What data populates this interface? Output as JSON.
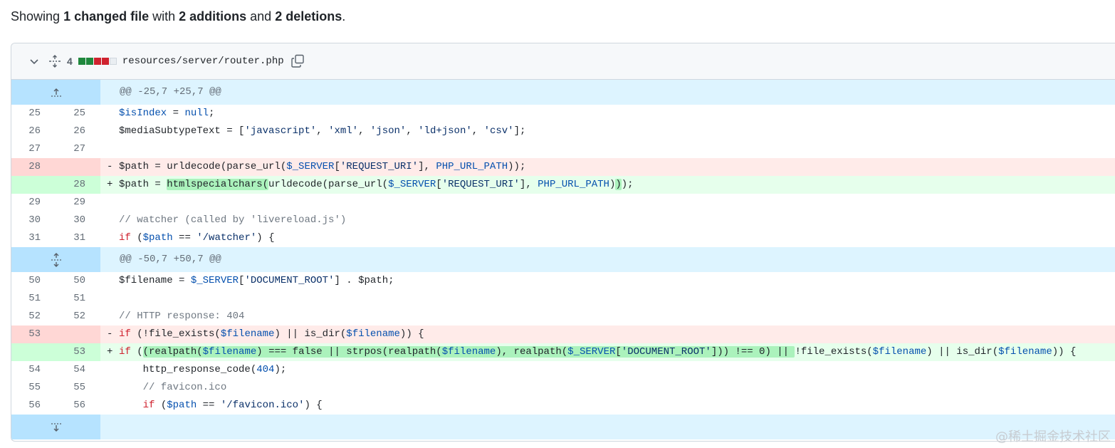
{
  "summary": {
    "prefix": "Showing ",
    "files": "1 changed file",
    "with": " with ",
    "additions": "2 additions",
    "and": " and ",
    "deletions": "2 deletions",
    "suffix": "."
  },
  "file": {
    "change_count": "4",
    "name": "resources/server/router.php",
    "diffstat": [
      "add",
      "add",
      "del",
      "del",
      "neutral"
    ]
  },
  "hunks": [
    {
      "header": "@@ -25,7 +25,7 @@"
    },
    {
      "header": "@@ -50,7 +50,7 @@"
    }
  ],
  "lines": [
    {
      "old": "25",
      "new": "25",
      "type": "context",
      "text": "$isIndex = null;"
    },
    {
      "old": "26",
      "new": "26",
      "type": "context",
      "text": "$mediaSubtypeText = ['javascript', 'xml', 'json', 'ld+json', 'csv'];"
    },
    {
      "old": "27",
      "new": "27",
      "type": "context",
      "text": ""
    },
    {
      "old": "28",
      "new": "",
      "type": "del",
      "text": "$path = urldecode(parse_url($_SERVER['REQUEST_URI'], PHP_URL_PATH));"
    },
    {
      "old": "",
      "new": "28",
      "type": "add",
      "text": "$path = htmlspecialchars(urldecode(parse_url($_SERVER['REQUEST_URI'], PHP_URL_PATH)));"
    },
    {
      "old": "29",
      "new": "29",
      "type": "context",
      "text": ""
    },
    {
      "old": "30",
      "new": "30",
      "type": "context",
      "text": "// watcher (called by 'livereload.js')"
    },
    {
      "old": "31",
      "new": "31",
      "type": "context",
      "text": "if ($path == '/watcher') {"
    },
    {
      "old": "50",
      "new": "50",
      "type": "context",
      "text": "$filename = $_SERVER['DOCUMENT_ROOT'] . $path;"
    },
    {
      "old": "51",
      "new": "51",
      "type": "context",
      "text": ""
    },
    {
      "old": "52",
      "new": "52",
      "type": "context",
      "text": "// HTTP response: 404"
    },
    {
      "old": "53",
      "new": "",
      "type": "del",
      "text": "if (!file_exists($filename) || is_dir($filename)) {"
    },
    {
      "old": "",
      "new": "53",
      "type": "add",
      "text": "if ((realpath($filename) === false || strpos(realpath($filename), realpath($_SERVER['DOCUMENT_ROOT'])) !== 0) || !file_exists($filename) || is_dir($filename)) {"
    },
    {
      "old": "54",
      "new": "54",
      "type": "context",
      "text": "    http_response_code(404);"
    },
    {
      "old": "55",
      "new": "55",
      "type": "context",
      "text": "    // favicon.ico"
    },
    {
      "old": "56",
      "new": "56",
      "type": "context",
      "text": "    if ($path == '/favicon.ico') {"
    }
  ],
  "markers": {
    "del": "-",
    "add": "+"
  },
  "watermark": "@稀土掘金技术社区",
  "icons": {
    "collapse": "chevron-down-icon",
    "unfold": "unfold-icon",
    "copy": "copy-icon",
    "expand_up": "expand-up-icon",
    "expand_both": "expand-both-icon",
    "expand_down": "expand-down-icon"
  },
  "colors": {
    "add_bg": "#e6ffec",
    "add_num_bg": "#ccffd8",
    "add_highlight": "#abf2bc",
    "del_bg": "#ffebe9",
    "del_num_bg": "#ffd7d5",
    "hunk_bg": "#ddf4ff",
    "hunk_expander_bg": "#b6e3ff"
  }
}
